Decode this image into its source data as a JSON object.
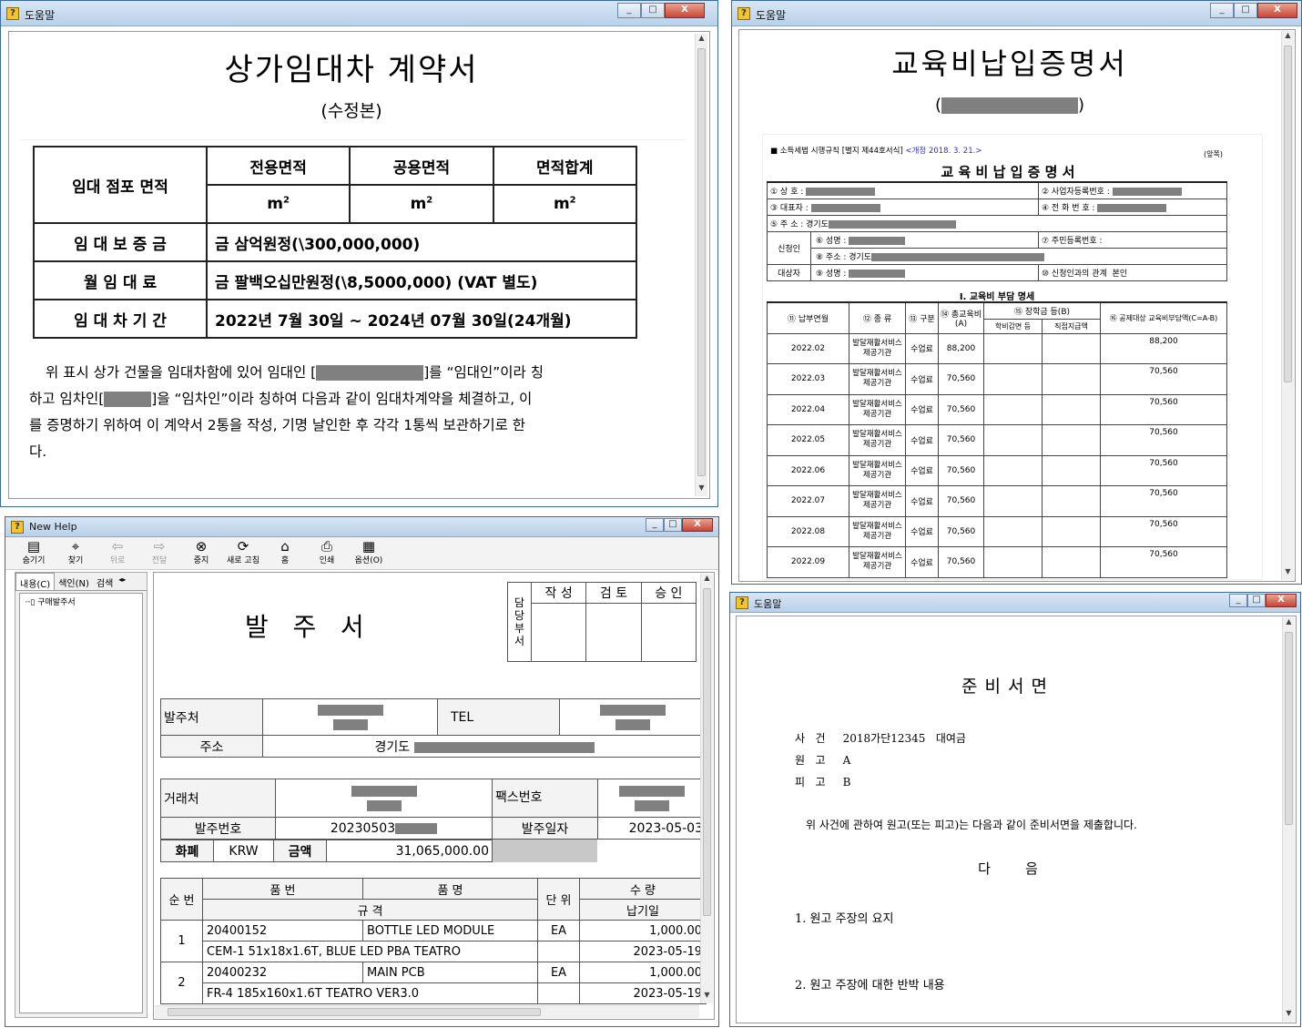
{
  "w1": {
    "title_bar": "도움말",
    "doc_title": "상가임대차 계약서",
    "subtitle": "(수정본)",
    "table": {
      "area_label": "임대 점포 면적",
      "area_cols": [
        "전용면적",
        "공용면적",
        "면적합계"
      ],
      "unit": "m",
      "unit_sup": "2",
      "deposit_label": "임 대 보 증 금",
      "deposit_value": "금 삼억원정(\\300,000,000)",
      "rent_label": "월   임   대   료",
      "rent_value": "금 팔백오십만원정(\\8,5000,000) (VAT 별도)",
      "period_label": "임 대 차 기 간",
      "period_value": "2022년 7월 30일 ~ 2024년 07월 30일(24개월)"
    },
    "para": [
      "위 표시 상가 건물을 임대차함에 있어 임대인 [",
      "]를 “임대인”이라 칭",
      "하고 임차인[",
      "]을 “임차인”이라 칭하여 다음과 같이 임대차계약을 체결하고, 이",
      "를 증명하기 위하여 이 계약서 2통을 작성, 기명 날인한 후 각각 1통씩 보관하기로 한",
      "다."
    ]
  },
  "w2": {
    "title_bar": "도움말",
    "doc_title": "교육비납입증명서",
    "form_ref": "■ 소득세법 시행규칙 [별지 제44호서식]",
    "form_rev": "<개정 2018. 3. 21.>",
    "form_side": "(앞쪽)",
    "form_title": "교 육 비 납 입 증 명 서",
    "fields": {
      "f1": "① 상    호 :",
      "f2": "② 사업자등록번호 :",
      "f3": "③ 대표자 :",
      "f4": "④ 전 화 번 호 :",
      "f5": "⑤ 주    소 : 경기도",
      "applicant": "신청인",
      "f6": "⑥ 성명 :",
      "f7": "⑦ 주민등록번호 :",
      "f8": "⑧ 주소 : 경기도",
      "target": "대상자",
      "f9": "⑨ 성명 :",
      "f10": "⑩ 신청인과의 관계",
      "f10_value": "본인"
    },
    "section": "Ⅰ. 교육비 부담 명세",
    "headers": {
      "h11": "⑪ 납부연월",
      "h12": "⑫ 종 류",
      "h13": "⑬ 구분",
      "h14": "⑭ 총교육비(A)",
      "h15": "⑮ 장학금 등(B)",
      "h15a": "학비감면 등",
      "h15b": "직접지급액",
      "h16": "⑯ 공제대상 교육비부담액(C=A-B)"
    },
    "rows": [
      {
        "month": "2022.02",
        "kind": "발달재활서비스 제공기관",
        "type": "수업료",
        "total": "88,200",
        "net": "88,200"
      },
      {
        "month": "2022.03",
        "kind": "발달재활서비스 제공기관",
        "type": "수업료",
        "total": "70,560",
        "net": "70,560"
      },
      {
        "month": "2022.04",
        "kind": "발달재활서비스 제공기관",
        "type": "수업료",
        "total": "70,560",
        "net": "70,560"
      },
      {
        "month": "2022.05",
        "kind": "발달재활서비스 제공기관",
        "type": "수업료",
        "total": "70,560",
        "net": "70,560"
      },
      {
        "month": "2022.06",
        "kind": "발달재활서비스 제공기관",
        "type": "수업료",
        "total": "70,560",
        "net": "70,560"
      },
      {
        "month": "2022.07",
        "kind": "발달재활서비스 제공기관",
        "type": "수업료",
        "total": "70,560",
        "net": "70,560"
      },
      {
        "month": "2022.08",
        "kind": "발달재활서비스 제공기관",
        "type": "수업료",
        "total": "70,560",
        "net": "70,560"
      },
      {
        "month": "2022.09",
        "kind": "발달재활서비스 제공기관",
        "type": "수업료",
        "total": "70,560",
        "net": "70,560"
      }
    ]
  },
  "w3": {
    "title_bar": "New Help",
    "toolbar": [
      "숨기기",
      "찾기",
      "뒤로",
      "전달",
      "중지",
      "새로 고침",
      "홈",
      "인쇄",
      "옵션(O)"
    ],
    "tabs": [
      "내용(C)",
      "색인(N)",
      "검색"
    ],
    "tree_item": "구매발주서",
    "doc_title": "발   주   서",
    "approval": {
      "dept": "담당부서",
      "cols": [
        "작 성",
        "검 토",
        "승 인"
      ]
    },
    "orderer_label": "발주처",
    "tel_label": "TEL",
    "address_label": "주소",
    "address_value": "경기도",
    "vendor_label": "거래처",
    "fax_label": "팩스번호",
    "order_no_label": "발주번호",
    "order_no_value": "20230503",
    "order_date_label": "발주일자",
    "order_date_value": "2023-05-03",
    "currency_label": "화폐",
    "currency_value": "KRW",
    "amount_label": "금액",
    "amount_value": "31,065,000.00",
    "items_headers": {
      "seq": "순 번",
      "part_no": "품 번",
      "part_name": "품 명",
      "spec": "규 격",
      "unit": "단 위",
      "qty": "수 량",
      "due": "납기일"
    },
    "items": [
      {
        "seq": "1",
        "part_no": "20400152",
        "part_name": "BOTTLE LED MODULE",
        "unit": "EA",
        "qty": "1,000.00",
        "spec": "CEM-1 51x18x1.6T, BLUE LED PBA TEATRO",
        "due": "2023-05-19"
      },
      {
        "seq": "2",
        "part_no": "20400232",
        "part_name": "MAIN PCB",
        "unit": "EA",
        "qty": "1,000.00",
        "spec": "FR-4 185x160x1.6T TEATRO VER3.0",
        "due": "2023-05-19"
      }
    ]
  },
  "w4": {
    "title_bar": "도움말",
    "doc_title": "준비서면",
    "case_label": "사   건",
    "case_value": "2018가단12345   대여금",
    "plaintiff_label": "원   고",
    "plaintiff_value": "A",
    "defendant_label": "피   고",
    "defendant_value": "B",
    "intro": "위 사건에 관하여 원고(또는 피고)는 다음과 같이 준비서면을 제출합니다.",
    "next": "다        음",
    "item1": "1. 원고 주장의 요지",
    "item2": "2. 원고 주장에 대한 반박 내용"
  },
  "controls": {
    "min": "_",
    "max": "□",
    "close": "X"
  }
}
